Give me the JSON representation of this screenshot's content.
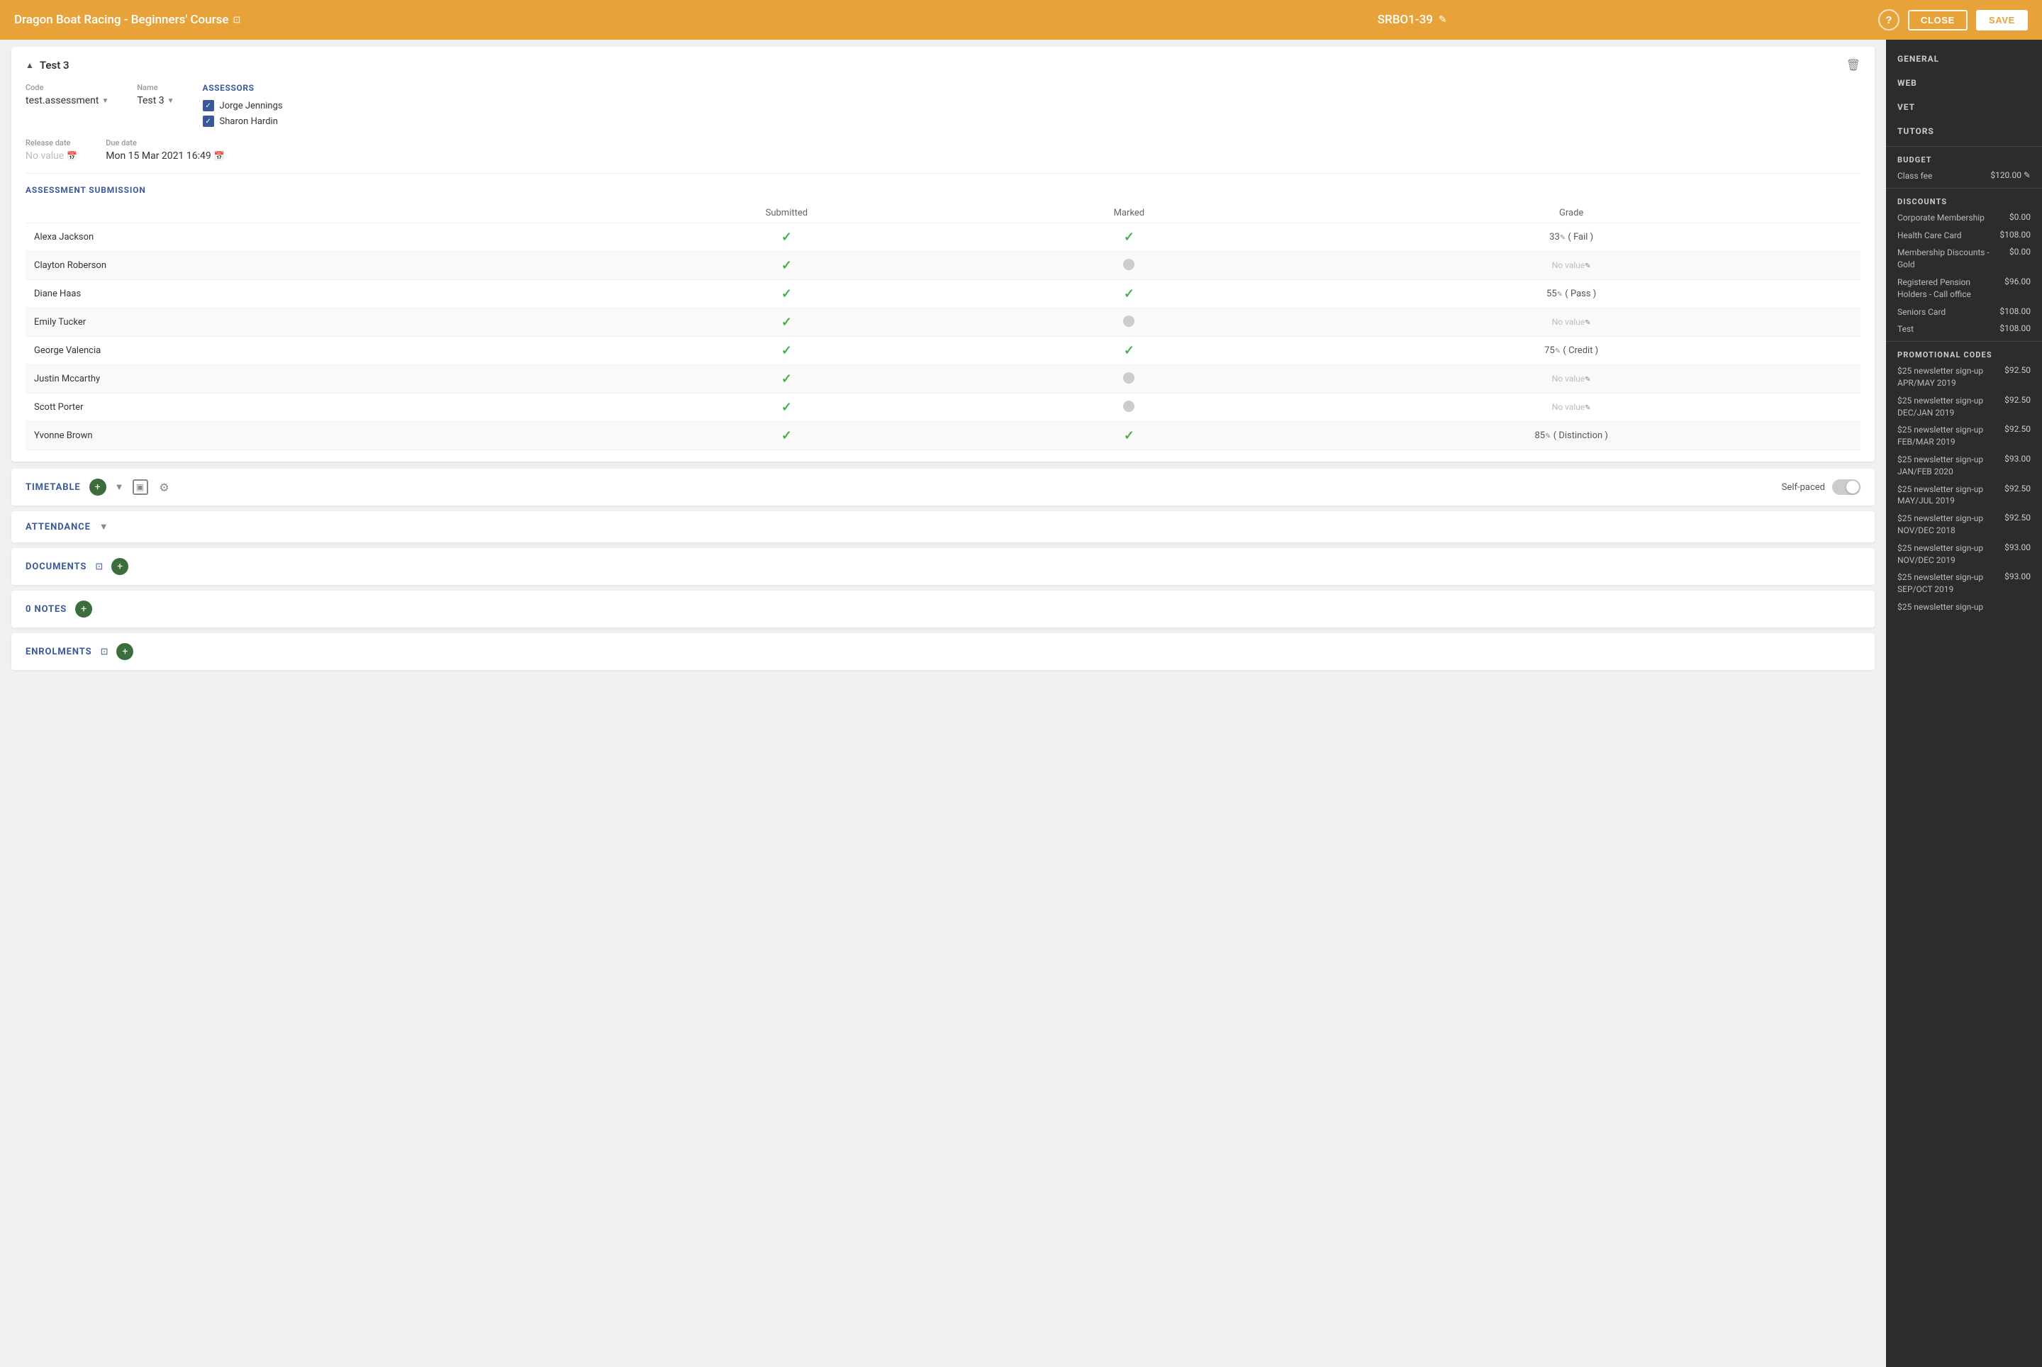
{
  "header": {
    "title": "Dragon Boat Racing - Beginners' Course",
    "title_ext_icon": "⊡",
    "course_code": "SRBO1-39",
    "edit_icon": "✎",
    "help_label": "?",
    "close_label": "CLOSE",
    "save_label": "SAVE"
  },
  "card": {
    "title": "Test 3",
    "collapse_icon": "▲",
    "code_label": "Code",
    "code_value": "test.assessment",
    "name_label": "Name",
    "name_value": "Test 3",
    "release_date_label": "Release date",
    "release_date_value": "No value",
    "due_date_label": "Due date",
    "due_date_value": "Mon 15 Mar 2021 16:49",
    "assessors_label": "ASSESSORS",
    "assessors": [
      {
        "name": "Jorge Jennings",
        "checked": true
      },
      {
        "name": "Sharon Hardin",
        "checked": true
      }
    ],
    "submission_section_title": "ASSESSMENT SUBMISSION",
    "submission_headers": [
      "",
      "Submitted",
      "Marked",
      "Grade"
    ],
    "submission_rows": [
      {
        "name": "Alexa Jackson",
        "submitted": true,
        "marked": true,
        "grade": "33",
        "grade_label": "( Fail )"
      },
      {
        "name": "Clayton Roberson",
        "submitted": true,
        "marked": false,
        "grade": null,
        "grade_label": ""
      },
      {
        "name": "Diane Haas",
        "submitted": true,
        "marked": true,
        "grade": "55",
        "grade_label": "( Pass )"
      },
      {
        "name": "Emily Tucker",
        "submitted": true,
        "marked": false,
        "grade": null,
        "grade_label": ""
      },
      {
        "name": "George Valencia",
        "submitted": true,
        "marked": true,
        "grade": "75",
        "grade_label": "( Credit )"
      },
      {
        "name": "Justin Mccarthy",
        "submitted": true,
        "marked": false,
        "grade": null,
        "grade_label": ""
      },
      {
        "name": "Scott Porter",
        "submitted": true,
        "marked": false,
        "grade": null,
        "grade_label": ""
      },
      {
        "name": "Yvonne Brown",
        "submitted": true,
        "marked": true,
        "grade": "85",
        "grade_label": "( Distinction )"
      }
    ]
  },
  "timetable_section": {
    "title": "TIMETABLE",
    "self_paced_label": "Self-paced"
  },
  "attendance_section": {
    "title": "ATTENDANCE"
  },
  "documents_section": {
    "title": "DOCUMENTS"
  },
  "notes_section": {
    "title": "0 NOTES"
  },
  "enrolments_section": {
    "title": "ENROLMENTS"
  },
  "sidebar": {
    "nav_items": [
      {
        "label": "GENERAL"
      },
      {
        "label": "WEB"
      },
      {
        "label": "VET"
      },
      {
        "label": "TUTORS"
      }
    ],
    "budget_label": "BUDGET",
    "class_fee_label": "Class fee",
    "class_fee_value": "$120.00",
    "discounts_label": "DISCOUNTS",
    "discounts": [
      {
        "label": "Corporate Membership",
        "value": "$0.00"
      },
      {
        "label": "Health Care Card",
        "value": "$108.00"
      },
      {
        "label": "Membership Discounts - Gold",
        "value": "$0.00"
      },
      {
        "label": "Registered Pension Holders - Call office",
        "value": "$96.00"
      },
      {
        "label": "Seniors Card",
        "value": "$108.00"
      },
      {
        "label": "Test",
        "value": "$108.00"
      }
    ],
    "promo_label": "PROMOTIONAL CODES",
    "promos": [
      {
        "label": "$25 newsletter sign-up APR/MAY 2019",
        "value": "$92.50"
      },
      {
        "label": "$25 newsletter sign-up DEC/JAN 2019",
        "value": "$92.50"
      },
      {
        "label": "$25 newsletter sign-up FEB/MAR 2019",
        "value": "$92.50"
      },
      {
        "label": "$25 newsletter sign-up JAN/FEB 2020",
        "value": "$93.00"
      },
      {
        "label": "$25 newsletter sign-up MAY/JUL 2019",
        "value": "$92.50"
      },
      {
        "label": "$25 newsletter sign-up NOV/DEC 2018",
        "value": "$92.50"
      },
      {
        "label": "$25 newsletter sign-up NOV/DEC 2019",
        "value": "$93.00"
      },
      {
        "label": "$25 newsletter sign-up SEP/OCT 2019",
        "value": "$93.00"
      },
      {
        "label": "$25 newsletter sign-up",
        "value": ""
      }
    ]
  }
}
